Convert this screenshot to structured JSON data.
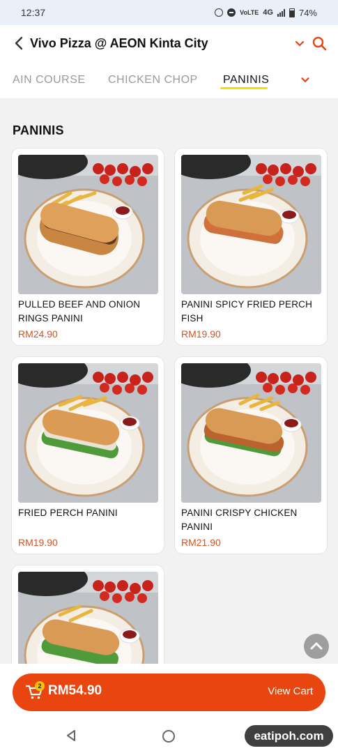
{
  "status_bar": {
    "time": "12:37",
    "network": "4G",
    "battery": "74%"
  },
  "header": {
    "title": "Vivo Pizza @ AEON Kinta City",
    "tabs": [
      {
        "label": "AIN COURSE"
      },
      {
        "label": "CHICKEN CHOP"
      },
      {
        "label": "PANINIS"
      }
    ],
    "active_tab": "PANINIS"
  },
  "section": {
    "title": "PANINIS"
  },
  "items": [
    {
      "name": "PULLED BEEF AND ONION RINGS PANINI",
      "price": "RM24.90"
    },
    {
      "name": "PANINI SPICY FRIED PERCH FISH",
      "price": "RM19.90"
    },
    {
      "name": "FRIED PERCH PANINI",
      "price": "RM19.90"
    },
    {
      "name": "PANINI CRISPY CHICKEN PANINI",
      "price": "RM21.90"
    },
    {
      "name": "",
      "price": ""
    }
  ],
  "cart": {
    "count": "2",
    "total": "RM54.90",
    "action_label": "View Cart"
  },
  "watermark": "eatipoh.com",
  "colors": {
    "accent": "#e84510",
    "price": "#d2541e",
    "tab_underline": "#f5e100",
    "badge": "#f7c300"
  }
}
